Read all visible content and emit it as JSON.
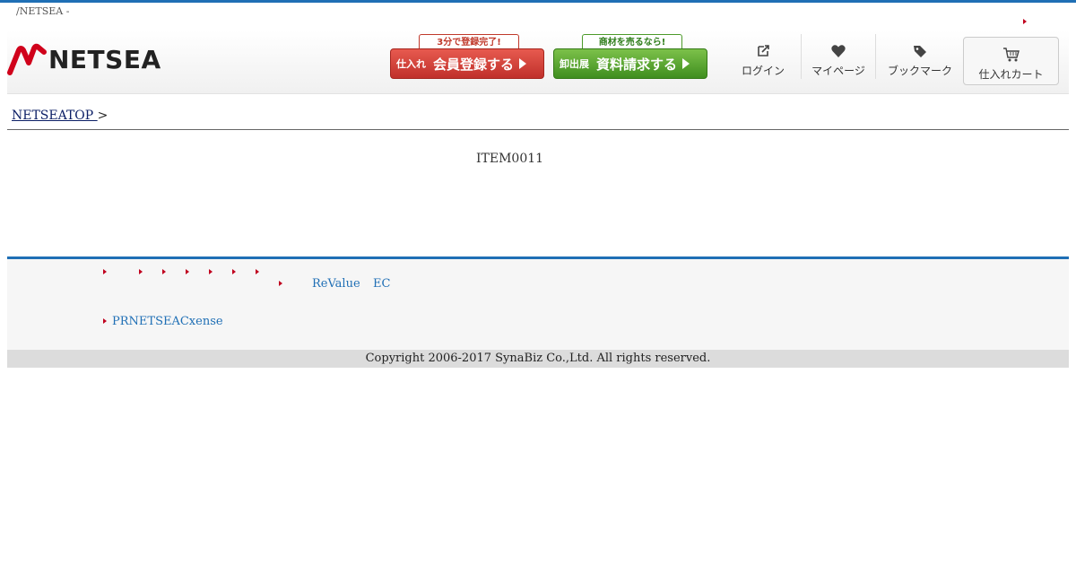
{
  "header": {
    "tagline": "/NETSEA -",
    "logo_text": "NETSEA",
    "cta_register": {
      "caption": "3分で登録完了!",
      "small": "仕入れ",
      "big": "会員登録する"
    },
    "cta_wholesale": {
      "caption": "商材を売るなら!",
      "small": "卸出展",
      "big": "資料請求する"
    },
    "nav": [
      {
        "label": "ログイン",
        "icon": "login-icon"
      },
      {
        "label": "マイページ",
        "icon": "heart-icon"
      },
      {
        "label": "ブックマーク",
        "icon": "tag-icon"
      },
      {
        "label": "仕入れカート",
        "icon": "cart-icon"
      }
    ]
  },
  "breadcrumb": {
    "home": "NETSEATOP ",
    "separator": ">"
  },
  "main": {
    "item_code": "ITEM0011"
  },
  "footer": {
    "links": [
      "ReValue",
      "EC",
      "PRNETSEACxense"
    ],
    "copyright": "Copyright 2006-2017 SynaBiz Co.,Ltd. All rights reserved."
  },
  "colors": {
    "accent": "#1f6fb5",
    "arrow": "#c0001e"
  }
}
